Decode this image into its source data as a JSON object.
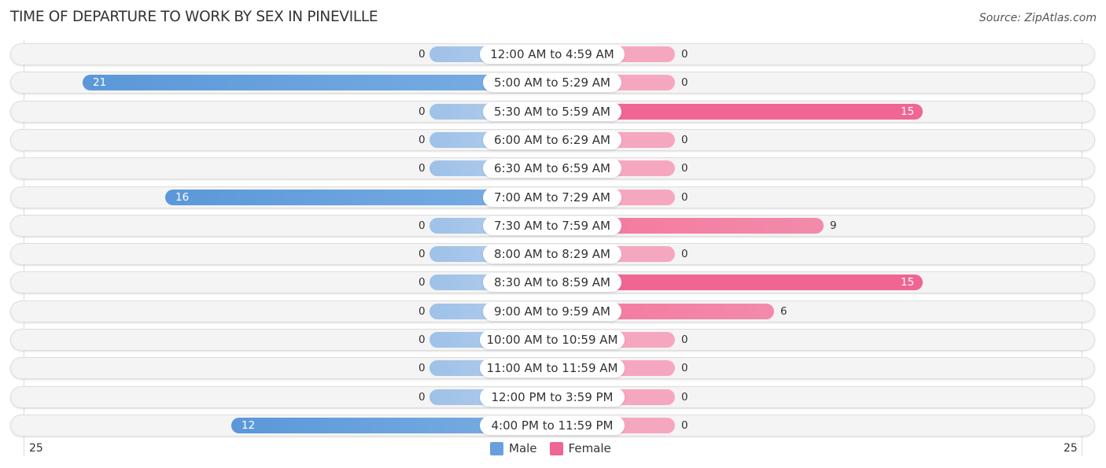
{
  "title": "TIME OF DEPARTURE TO WORK BY SEX IN PINEVILLE",
  "source": "Source: ZipAtlas.com",
  "colors": {
    "male": "#6a9fdd",
    "female": "#f06592"
  },
  "chart_data": {
    "type": "bar",
    "orientation": "horizontal-diverging",
    "title": "TIME OF DEPARTURE TO WORK BY SEX IN PINEVILLE",
    "categories": [
      "12:00 AM to 4:59 AM",
      "5:00 AM to 5:29 AM",
      "5:30 AM to 5:59 AM",
      "6:00 AM to 6:29 AM",
      "6:30 AM to 6:59 AM",
      "7:00 AM to 7:29 AM",
      "7:30 AM to 7:59 AM",
      "8:00 AM to 8:29 AM",
      "8:30 AM to 8:59 AM",
      "9:00 AM to 9:59 AM",
      "10:00 AM to 10:59 AM",
      "11:00 AM to 11:59 AM",
      "12:00 PM to 3:59 PM",
      "4:00 PM to 11:59 PM"
    ],
    "series": [
      {
        "name": "Male",
        "values": [
          0,
          21,
          0,
          0,
          0,
          16,
          0,
          0,
          0,
          0,
          0,
          0,
          0,
          12
        ]
      },
      {
        "name": "Female",
        "values": [
          0,
          0,
          15,
          0,
          0,
          0,
          9,
          0,
          15,
          6,
          0,
          0,
          0,
          0
        ]
      }
    ],
    "axis": {
      "left_label": "25",
      "right_label": "25",
      "range": [
        0,
        25
      ]
    },
    "legend": {
      "position": "bottom-center",
      "entries": [
        "Male",
        "Female"
      ]
    },
    "xlabel": "",
    "ylabel": ""
  }
}
